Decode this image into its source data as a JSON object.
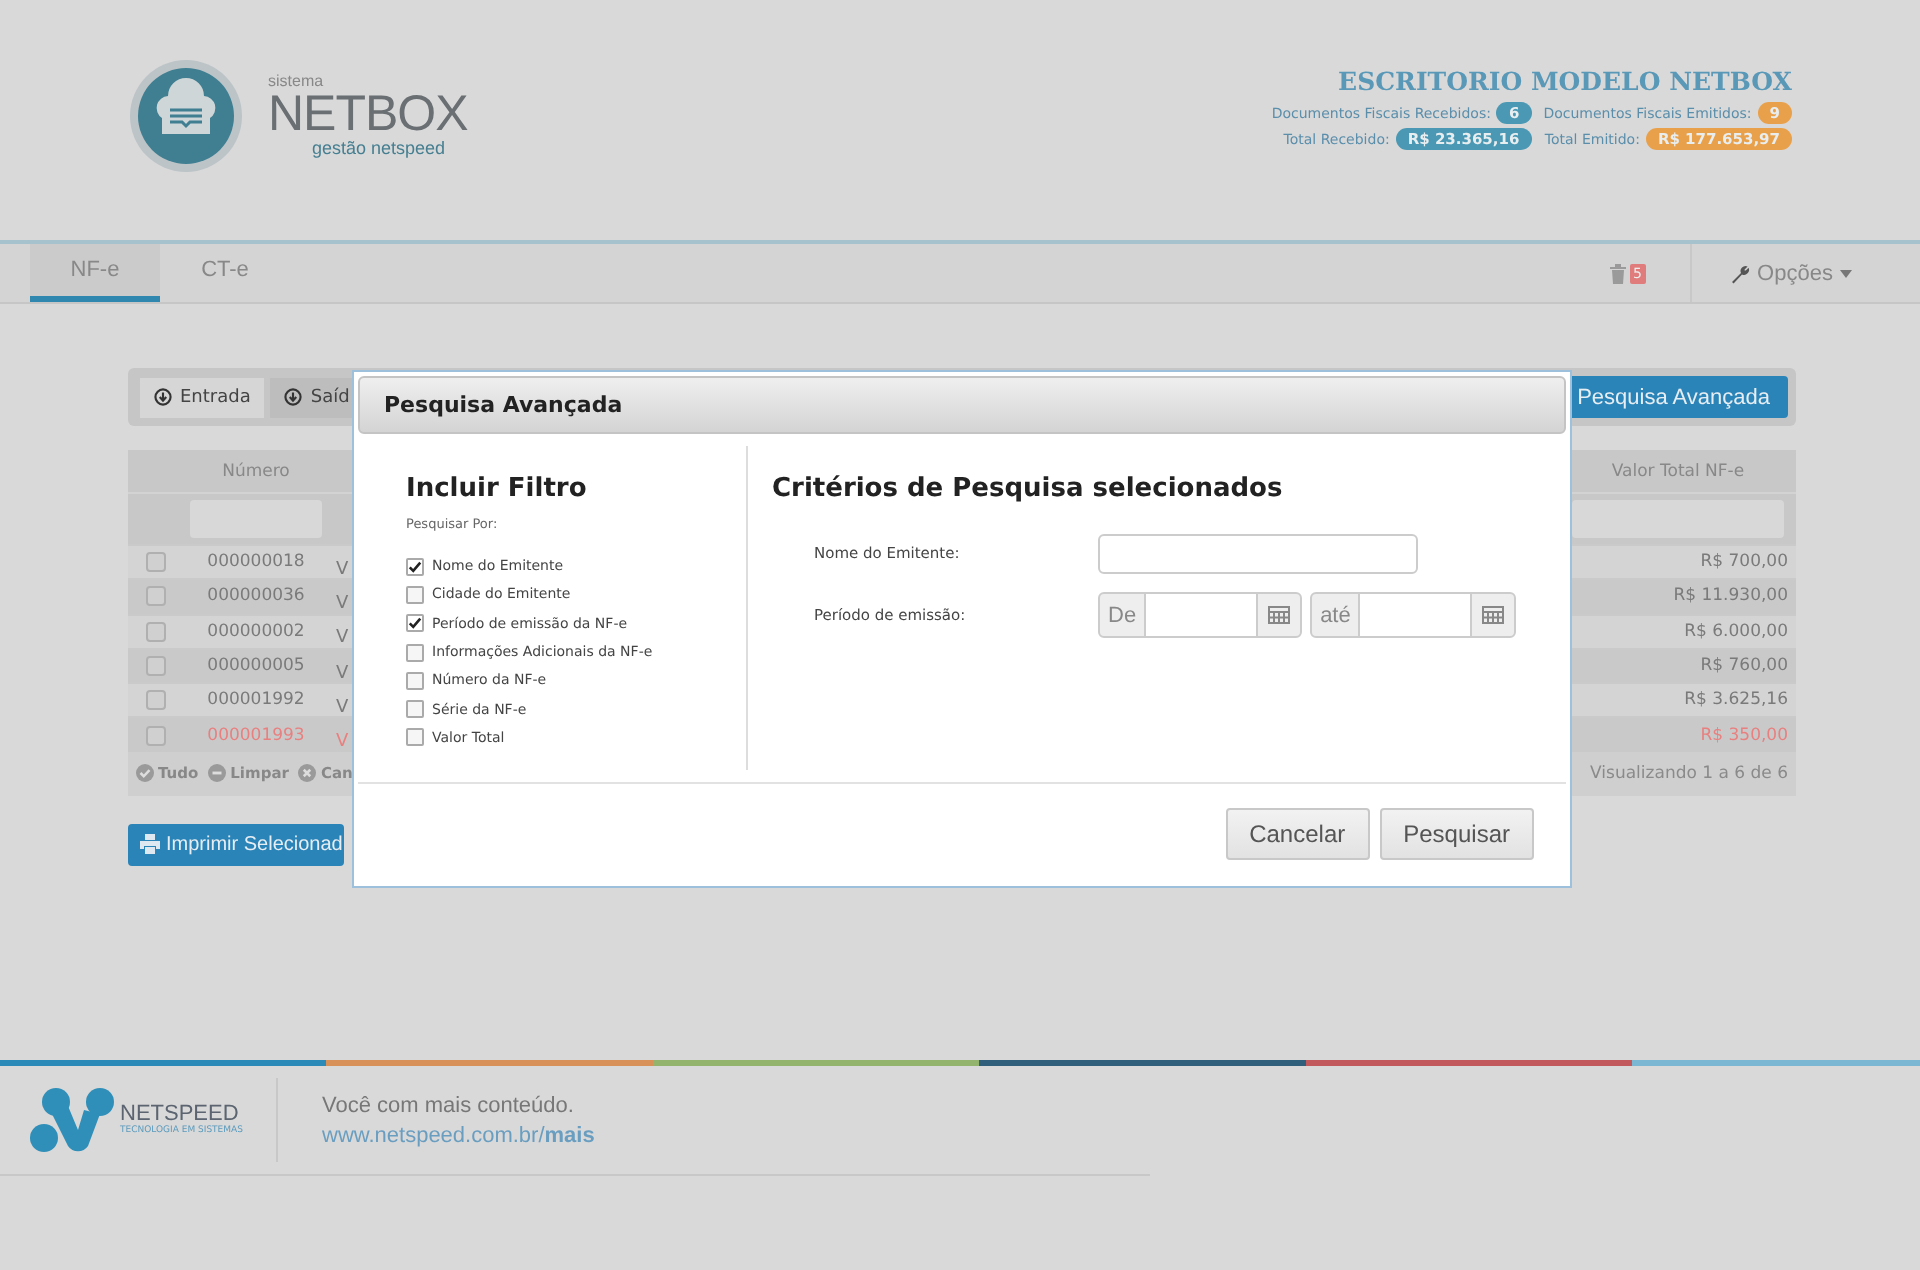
{
  "header": {
    "logo": {
      "small": "sistema",
      "name": "NETBOX",
      "tagline": "gestão netspeed"
    },
    "company": "ESCRITORIO MODELO NETBOX",
    "stats": [
      {
        "label": "Documentos Fiscais Recebidos:",
        "value": "6",
        "color": "#4a98b3"
      },
      {
        "label": "Documentos Fiscais Emitidos:",
        "value": "9",
        "color": "#e9a04a"
      },
      {
        "label": "Total Recebido:",
        "value": "R$ 23.365,16",
        "color": "#4a98b3"
      },
      {
        "label": "Total Emitido:",
        "value": "R$ 177.653,97",
        "color": "#e9a04a"
      }
    ]
  },
  "nav": {
    "tabs": [
      {
        "label": "NF-e",
        "selected": true
      },
      {
        "label": "CT-e",
        "selected": false
      }
    ],
    "trash_count": "5",
    "options": "Opções"
  },
  "toolbar": {
    "buttons": [
      {
        "label": "Entrada",
        "selected": true
      },
      {
        "label": "Saíd",
        "selected": false
      }
    ],
    "advanced_search": "Pesquisa Avançada"
  },
  "table": {
    "columns": [
      "Número",
      "Valor Total NF-e"
    ],
    "rows": [
      {
        "number": "000000018",
        "column_3": "V",
        "value": "R$ 700,00",
        "alert": false
      },
      {
        "number": "000000036",
        "column_3": "V",
        "value": "R$ 11.930,00",
        "alert": false
      },
      {
        "number": "000000002",
        "column_3": "V",
        "value": "R$ 6.000,00",
        "alert": false
      },
      {
        "number": "000000005",
        "column_3": "V",
        "value": "R$ 760,00",
        "alert": false
      },
      {
        "number": "000001992",
        "column_3": "V",
        "value": "R$ 3.625,16",
        "alert": false
      },
      {
        "number": "000001993",
        "column_3": "V",
        "value": "R$ 350,00",
        "alert": true
      }
    ],
    "actions": [
      {
        "kind": "check",
        "label": "Tudo"
      },
      {
        "kind": "minus",
        "label": "Limpar"
      },
      {
        "kind": "cross",
        "label": "Can"
      }
    ],
    "pagination": "Visualizando 1 a 6 de 6"
  },
  "print_button": "Imprimir Selecionad",
  "modal": {
    "title": "Pesquisa Avançada",
    "filter_title": "Incluir Filtro",
    "filter_subtitle": "Pesquisar Por:",
    "filters": [
      {
        "label": "Nome do Emitente",
        "checked": true
      },
      {
        "label": "Cidade do Emitente",
        "checked": false
      },
      {
        "label": "Período de emissão da NF-e",
        "checked": true
      },
      {
        "label": "Informações Adicionais da NF-e",
        "checked": false
      },
      {
        "label": "Número da NF-e",
        "checked": false
      },
      {
        "label": "Série da NF-e",
        "checked": false
      },
      {
        "label": "Valor Total",
        "checked": false
      }
    ],
    "criteria_title": "Critérios de Pesquisa selecionados",
    "name_label": "Nome do Emitente:",
    "period_label": "Período de emissão:",
    "from_label": "De",
    "to_label": "até",
    "buttons": [
      "Cancelar",
      "Pesquisar"
    ]
  },
  "footer": {
    "brand": "NETSPEED",
    "brand_tagline": "TECNOLOGIA EM SISTEMAS",
    "slogan": "Você com mais conteúdo.",
    "link": "www.netspeed.com.br/**mais**"
  }
}
